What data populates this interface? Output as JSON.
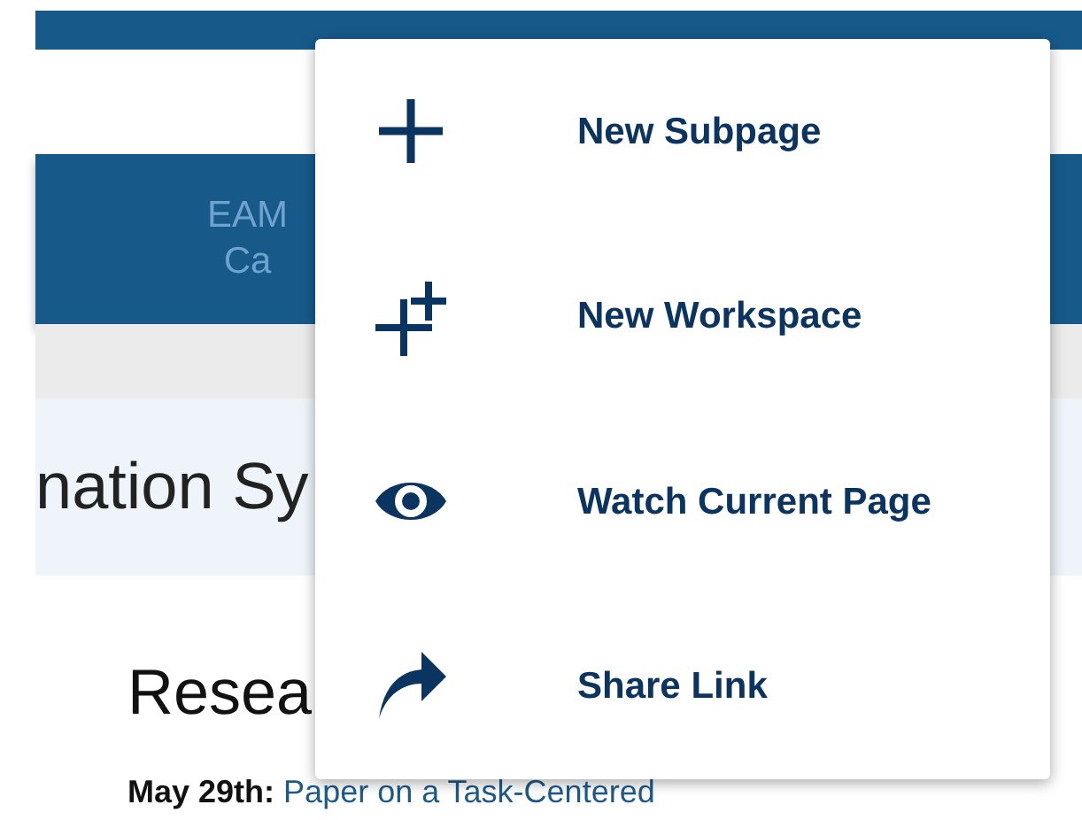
{
  "header": {
    "nav_label_lines": [
      "EAM",
      "Ca"
    ]
  },
  "banner": {
    "title": "nation Sy"
  },
  "content": {
    "heading": "Resea",
    "news": [
      {
        "date": "May 29th:",
        "link": "Paper on a Task-Centered"
      }
    ]
  },
  "menu": {
    "items": [
      {
        "kind": "plus",
        "label": "New Subpage"
      },
      {
        "kind": "plus-plus",
        "label": "New Workspace"
      },
      {
        "kind": "eye",
        "label": "Watch Current Page"
      },
      {
        "kind": "share",
        "label": "Share Link"
      }
    ]
  }
}
